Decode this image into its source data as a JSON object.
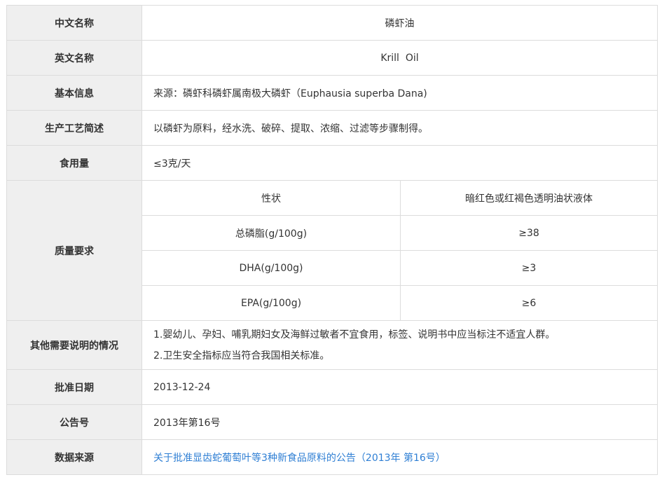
{
  "rows": {
    "cn_name": {
      "label": "中文名称",
      "value": "磷虾油"
    },
    "en_name": {
      "label": "英文名称",
      "value": "Krill  Oil"
    },
    "basic_info": {
      "label": "基本信息",
      "value": "来源：磷虾科磷虾属南极大磷虾（Euphausia superba Dana)"
    },
    "process": {
      "label": "生产工艺简述",
      "value": "以磷虾为原料，经水洗、破碎、提取、浓缩、过滤等步骤制得。"
    },
    "dosage": {
      "label": "食用量",
      "value": "≤3克/天"
    },
    "quality": {
      "label": "质量要求",
      "items": [
        {
          "name": "性状",
          "value": "暗红色或红褐色透明油状液体"
        },
        {
          "name": "总磷脂(g/100g)",
          "value": "≥38"
        },
        {
          "name": "DHA(g/100g)",
          "value": "≥3"
        },
        {
          "name": "EPA(g/100g)",
          "value": "≥6"
        }
      ]
    },
    "notes": {
      "label": "其他需要说明的情况",
      "lines": [
        "1.婴幼儿、孕妇、哺乳期妇女及海鲜过敏者不宜食用，标签、说明书中应当标注不适宜人群。",
        "2.卫生安全指标应当符合我国相关标准。"
      ]
    },
    "approval_date": {
      "label": "批准日期",
      "value": "2013-12-24"
    },
    "announcement": {
      "label": "公告号",
      "value": "2013年第16号"
    },
    "source": {
      "label": "数据来源",
      "value": "关于批准显齿蛇葡萄叶等3种新食品原料的公告（2013年 第16号）"
    }
  },
  "colors": {
    "label_bg": "#efefef",
    "border": "#dcdcdc",
    "link": "#2f7fd4",
    "text": "#333333"
  }
}
